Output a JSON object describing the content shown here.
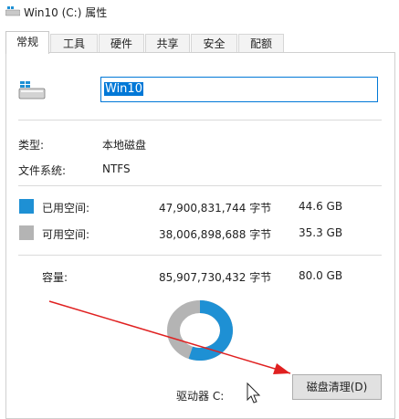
{
  "window": {
    "title": "Win10 (C:) 属性"
  },
  "tabs": [
    {
      "label": "常规",
      "active": true
    },
    {
      "label": "工具"
    },
    {
      "label": "硬件"
    },
    {
      "label": "共享"
    },
    {
      "label": "安全"
    },
    {
      "label": "配额"
    }
  ],
  "general": {
    "drive_name_value": "Win10",
    "type_label": "类型:",
    "type_value": "本地磁盘",
    "fs_label": "文件系统:",
    "fs_value": "NTFS",
    "used": {
      "label": "已用空间:",
      "bytes": "47,900,831,744 字节",
      "size": "44.6 GB",
      "color": "#1e90d4"
    },
    "free": {
      "label": "可用空间:",
      "bytes": "38,006,898,688 字节",
      "size": "35.3 GB",
      "color": "#b4b4b4"
    },
    "capacity": {
      "label": "容量:",
      "bytes": "85,907,730,432 字节",
      "size": "80.0 GB"
    },
    "used_fraction": 0.557,
    "drive_label": "驱动器 C:",
    "cleanup_button": "磁盘清理(D)"
  },
  "annotation": {
    "arrow_color": "#e02020"
  }
}
